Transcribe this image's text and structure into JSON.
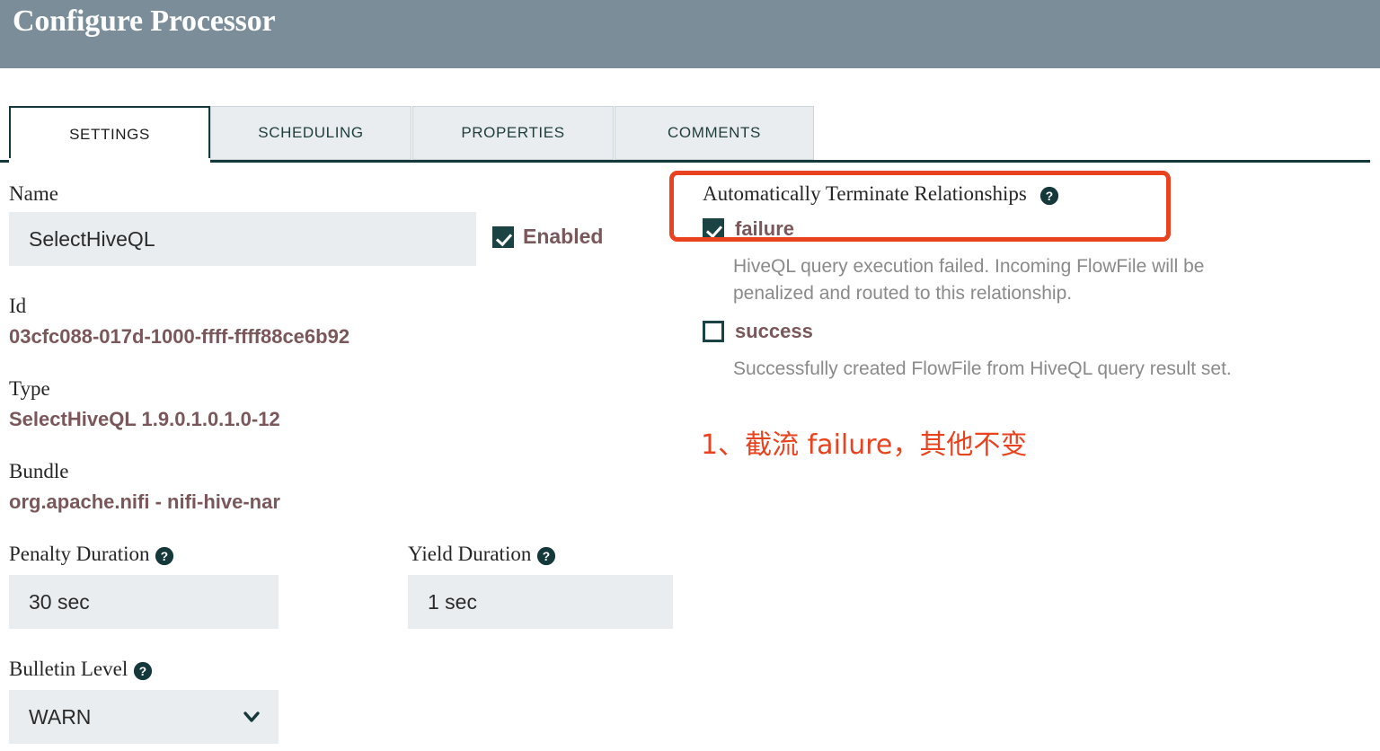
{
  "window": {
    "title": "Configure Processor",
    "header_color": "#7A8D99"
  },
  "tabs": [
    {
      "label": "SETTINGS",
      "active": true
    },
    {
      "label": "SCHEDULING",
      "active": false
    },
    {
      "label": "PROPERTIES",
      "active": false
    },
    {
      "label": "COMMENTS",
      "active": false
    }
  ],
  "settings": {
    "name_label": "Name",
    "name_value": "SelectHiveQL",
    "enabled_label": "Enabled",
    "enabled_checked": true,
    "id_label": "Id",
    "id_value": "03cfc088-017d-1000-ffff-ffff88ce6b92",
    "type_label": "Type",
    "type_value": "SelectHiveQL 1.9.0.1.0.1.0-12",
    "bundle_label": "Bundle",
    "bundle_value": "org.apache.nifi - nifi-hive-nar",
    "penalty_label": "Penalty Duration",
    "penalty_value": "30 sec",
    "yield_label": "Yield Duration",
    "yield_value": "1 sec",
    "bulletin_label": "Bulletin Level",
    "bulletin_value": "WARN",
    "help_icon": "question-mark-circle-icon",
    "chevron_icon": "chevron-down-icon"
  },
  "relationships": {
    "title": "Automatically Terminate Relationships",
    "help_icon": "question-mark-circle-icon",
    "items": [
      {
        "name": "failure",
        "checked": true,
        "description": "HiveQL query execution failed. Incoming FlowFile will be\npenalized and routed to this relationship."
      },
      {
        "name": "success",
        "checked": false,
        "description": "Successfully created FlowFile from HiveQL query result set."
      }
    ]
  },
  "annotation": {
    "text": "1、截流 failure，其他不变",
    "color": "#E8421F",
    "highlight_target": "failure-relationship-row"
  },
  "colors": {
    "accent_teal": "#15393B",
    "value_mauve": "#79575A",
    "input_bg": "#E9EDF0",
    "description_gray": "#8A8A8A",
    "annotation_red": "#E8421F"
  }
}
